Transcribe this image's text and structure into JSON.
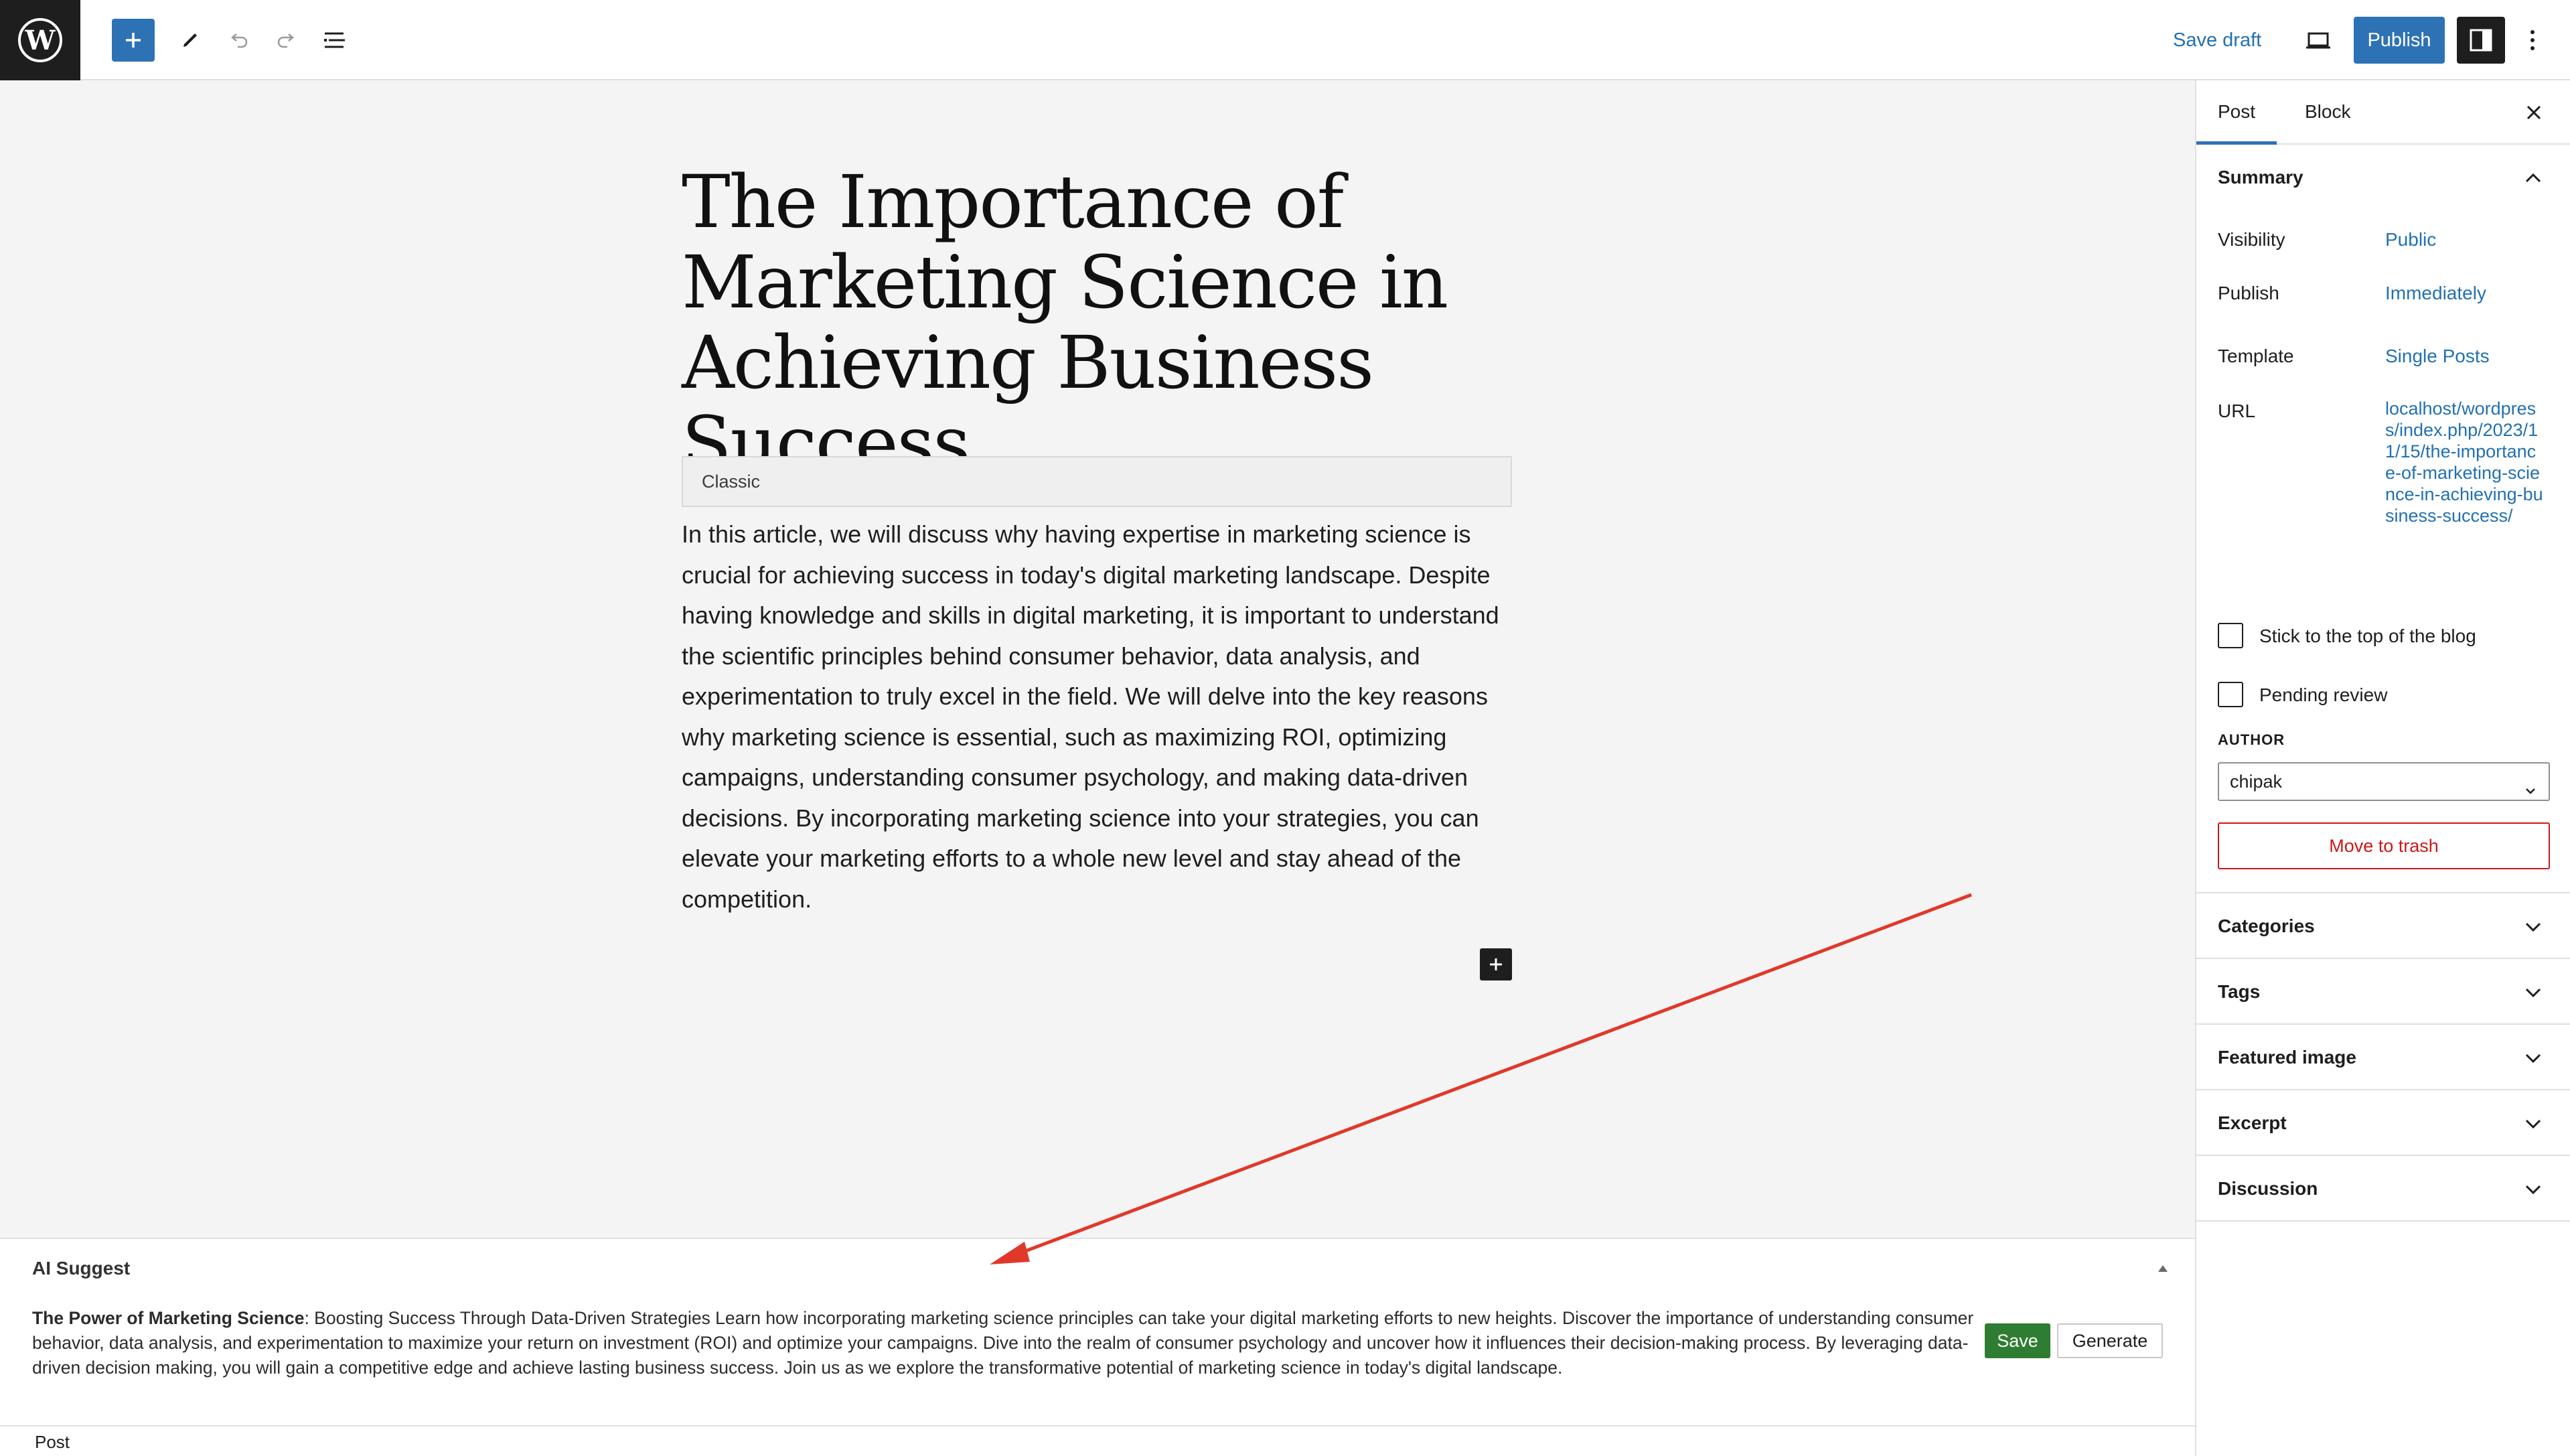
{
  "toolbar": {
    "add_block": "Add block",
    "save_draft": "Save draft",
    "publish": "Publish"
  },
  "post": {
    "title": "The Importance of Marketing Science in Achieving Business Success",
    "classic_label": "Classic",
    "body": "In this article, we will discuss why having expertise in marketing science is crucial for achieving success in today's digital marketing landscape. Despite having knowledge and skills in digital marketing, it is important to understand the scientific principles behind consumer behavior, data analysis, and experimentation to truly excel in the field. We will delve into the key reasons why marketing science is essential, such as maximizing ROI, optimizing campaigns, understanding consumer psychology, and making data-driven decisions. By incorporating marketing science into your strategies, you can elevate your marketing efforts to a whole new level and stay ahead of the competition."
  },
  "ai_suggest": {
    "title": "AI Suggest",
    "bold_lead": "The Power of Marketing Science",
    "text": ": Boosting Success Through Data-Driven Strategies Learn how incorporating marketing science principles can take your digital marketing efforts to new heights. Discover the importance of understanding consumer behavior, data analysis, and experimentation to maximize your return on investment (ROI) and optimize your campaigns. Dive into the realm of consumer psychology and uncover how it influences their decision-making process. By leveraging data-driven decision making, you will gain a competitive edge and achieve lasting business success. Join us as we explore the transformative potential of marketing science in today's digital landscape.",
    "save": "Save",
    "generate": "Generate"
  },
  "footer": {
    "breadcrumb": "Post"
  },
  "sidebar": {
    "tabs": [
      "Post",
      "Block"
    ],
    "summary": {
      "title": "Summary",
      "visibility_label": "Visibility",
      "visibility_value": "Public",
      "publish_label": "Publish",
      "publish_value": "Immediately",
      "template_label": "Template",
      "template_value": "Single Posts",
      "url_label": "URL",
      "url_value": "localhost/wordpress/index.php/2023/11/15/the-importance-of-marketing-science-in-achieving-business-success/",
      "stick_label": "Stick to the top of the blog",
      "pending_label": "Pending review",
      "author_label": "AUTHOR",
      "author_value": "chipak",
      "trash": "Move to trash"
    },
    "sections": [
      "Categories",
      "Tags",
      "Featured image",
      "Excerpt",
      "Discussion"
    ]
  },
  "colors": {
    "accent": "#2e72b6",
    "link": "#2271b1",
    "danger": "#cc1818",
    "success": "#2e7d32",
    "annotation_arrow": "#e0392b"
  }
}
